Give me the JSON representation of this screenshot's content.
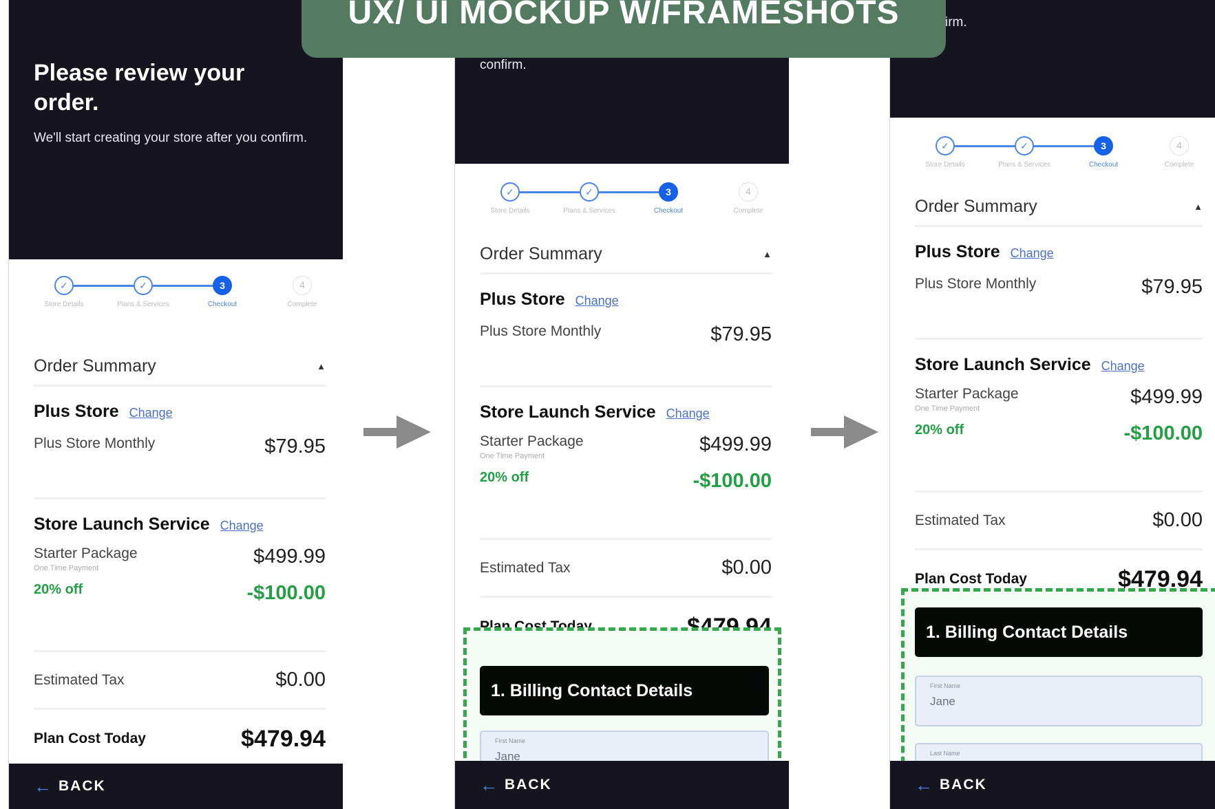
{
  "banner": {
    "title": "UX/ UI MOCKUP W/FRAMESHOTS"
  },
  "header": {
    "title": "Please review your order.",
    "subtitle": "We'll start creating your store after you confirm.",
    "frame2_fragment": "confirm.",
    "frame3_fragment": "irm."
  },
  "stepper": {
    "steps": [
      {
        "label": "Store Details",
        "state": "done",
        "marker": "✓"
      },
      {
        "label": "Plans & Services",
        "state": "done",
        "marker": "✓"
      },
      {
        "label": "Checkout",
        "state": "active",
        "marker": "3"
      },
      {
        "label": "Complete",
        "state": "todo",
        "marker": "4"
      }
    ]
  },
  "summary": {
    "heading": "Order Summary",
    "change_label": "Change",
    "plus_store": {
      "title": "Plus Store",
      "item": "Plus Store Monthly",
      "price": "$79.95"
    },
    "launch": {
      "title": "Store Launch Service",
      "item": "Starter Package",
      "sub": "One Time Payment",
      "price": "$499.99",
      "discount_label": "20% off",
      "discount_value": "-$100.00"
    },
    "tax": {
      "label": "Estimated Tax",
      "value": "$0.00"
    },
    "total": {
      "label": "Plan Cost Today",
      "value": "$479.94"
    }
  },
  "billing": {
    "title": "1. Billing Contact Details",
    "first_name_label": "First Name",
    "first_name_value": "Jane",
    "last_name_label": "Last Name"
  },
  "footer": {
    "back_label": "BACK"
  },
  "colors": {
    "dark": "#15141f",
    "accent": "#1661e8",
    "green": "#21a144",
    "banner": "#547a61"
  },
  "icons": {
    "step_done": "check-circle-icon",
    "back": "left-arrow-icon",
    "collapse": "caret-up-icon",
    "flow": "right-arrow-icon"
  }
}
